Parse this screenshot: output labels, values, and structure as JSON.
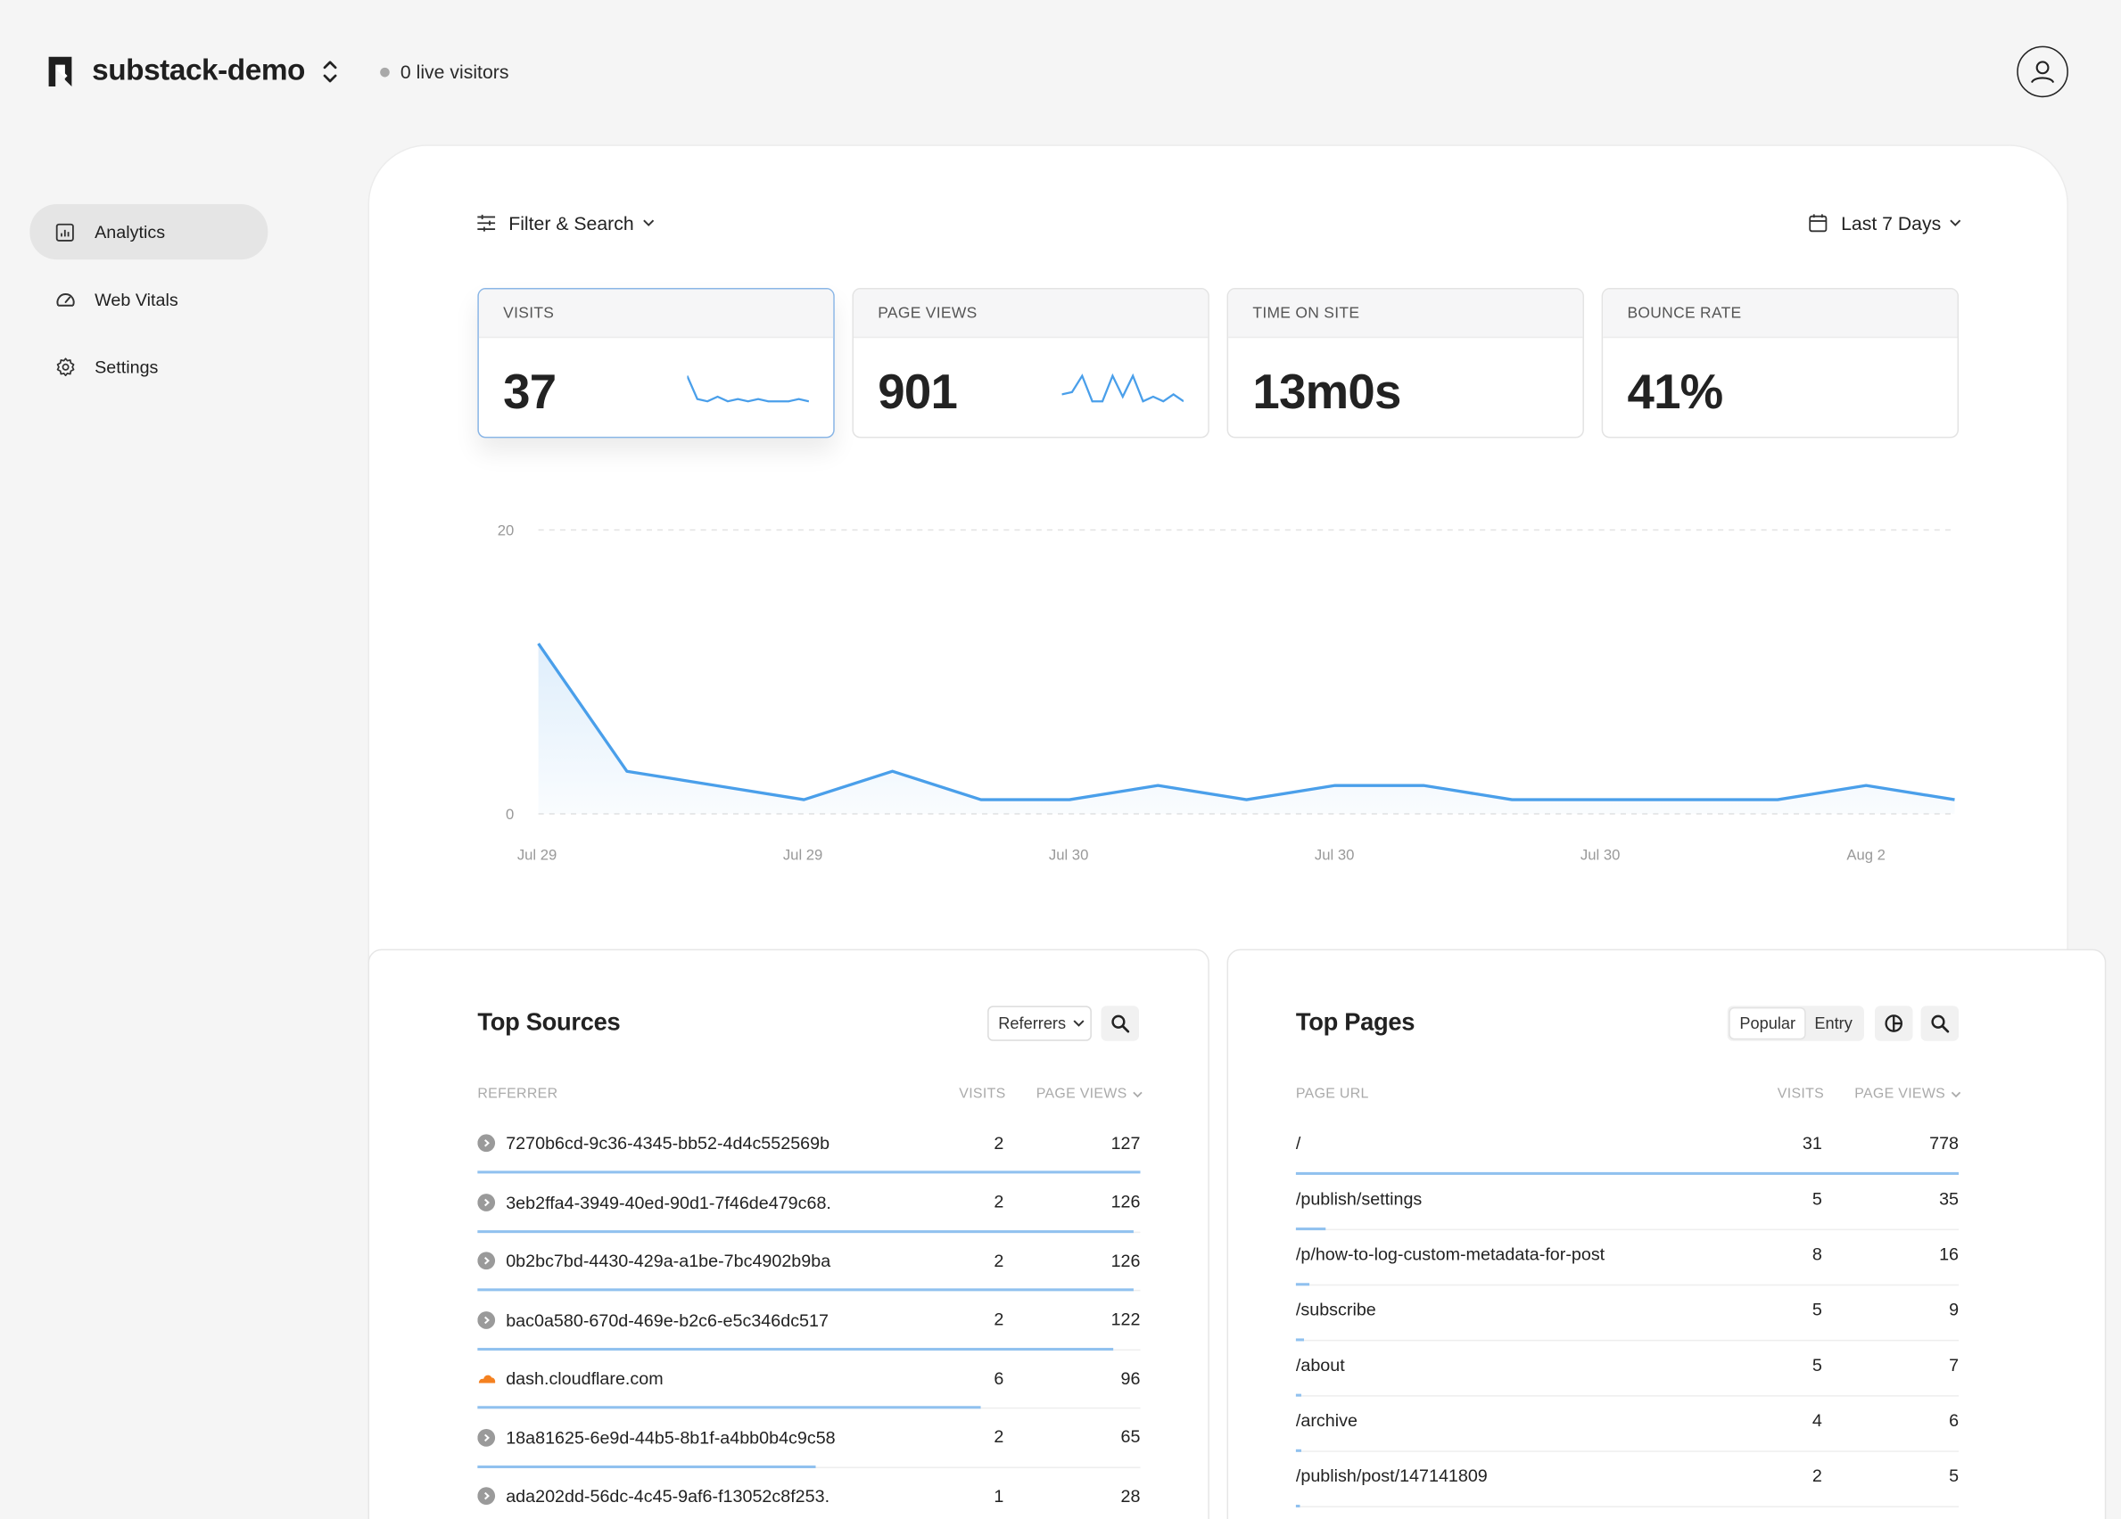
{
  "header": {
    "site_name": "substack-demo",
    "live_visitors": "0 live visitors"
  },
  "sidebar": {
    "items": [
      {
        "label": "Analytics",
        "icon": "bar-chart-icon",
        "active": true
      },
      {
        "label": "Web Vitals",
        "icon": "gauge-icon",
        "active": false
      },
      {
        "label": "Settings",
        "icon": "gear-icon",
        "active": false
      }
    ]
  },
  "toolbar": {
    "filter_label": "Filter & Search",
    "date_range_label": "Last 7 Days"
  },
  "kpis": [
    {
      "label": "VISITS",
      "value": "37",
      "sparkline": [
        14,
        4,
        3,
        5,
        3,
        4,
        3,
        4,
        3,
        3,
        3,
        4,
        3
      ],
      "active": true
    },
    {
      "label": "PAGE VIEWS",
      "value": "901",
      "sparkline": [
        6,
        7,
        14,
        3,
        3,
        14,
        5,
        14,
        3,
        5,
        3,
        6,
        3
      ],
      "active": false
    },
    {
      "label": "TIME ON SITE",
      "value": "13m0s",
      "active": false
    },
    {
      "label": "BOUNCE RATE",
      "value": "41%",
      "active": false
    }
  ],
  "chart_data": {
    "type": "area",
    "title": "",
    "xlabel": "",
    "ylabel": "",
    "ylim": [
      0,
      20
    ],
    "y_ticks": [
      "0",
      "20"
    ],
    "x_tick_labels": [
      "Jul 29",
      "Jul 29",
      "Jul 30",
      "Jul 30",
      "Jul 30",
      "Aug  2"
    ],
    "values": [
      12,
      3,
      2,
      1,
      3,
      1,
      1,
      2,
      1,
      2,
      2,
      1,
      1,
      1,
      1,
      2,
      1
    ],
    "grid": "dashed horizontal",
    "color": "#4a9fea"
  },
  "top_sources": {
    "title": "Top Sources",
    "selector": "Referrers",
    "columns": [
      "REFERRER",
      "VISITS",
      "PAGE VIEWS"
    ],
    "rows": [
      {
        "name": "7270b6cd-9c36-4345-bb52-4d4c552569b",
        "visits": "2",
        "page_views": "127",
        "share": 1.0,
        "icon": "referrer-icon"
      },
      {
        "name": "3eb2ffa4-3949-40ed-90d1-7f46de479c68.",
        "visits": "2",
        "page_views": "126",
        "share": 0.99,
        "icon": "referrer-icon"
      },
      {
        "name": "0b2bc7bd-4430-429a-a1be-7bc4902b9ba",
        "visits": "2",
        "page_views": "126",
        "share": 0.99,
        "icon": "referrer-icon"
      },
      {
        "name": "bac0a580-670d-469e-b2c6-e5c346dc517",
        "visits": "2",
        "page_views": "122",
        "share": 0.96,
        "icon": "referrer-icon"
      },
      {
        "name": "dash.cloudflare.com",
        "visits": "6",
        "page_views": "96",
        "share": 0.76,
        "icon": "cloudflare-icon"
      },
      {
        "name": "18a81625-6e9d-44b5-8b1f-a4bb0b4c9c58",
        "visits": "2",
        "page_views": "65",
        "share": 0.51,
        "icon": "referrer-icon"
      },
      {
        "name": "ada202dd-56dc-4c45-9af6-f13052c8f253.",
        "visits": "1",
        "page_views": "28",
        "share": 0.22,
        "icon": "referrer-icon"
      }
    ]
  },
  "top_pages": {
    "title": "Top Pages",
    "tabs": [
      "Popular",
      "Entry"
    ],
    "active_tab": "Popular",
    "columns": [
      "PAGE URL",
      "VISITS",
      "PAGE VIEWS"
    ],
    "rows": [
      {
        "name": "/",
        "visits": "31",
        "page_views": "778",
        "share": 1.0
      },
      {
        "name": "/publish/settings",
        "visits": "5",
        "page_views": "35",
        "share": 0.045
      },
      {
        "name": "/p/how-to-log-custom-metadata-for-post",
        "visits": "8",
        "page_views": "16",
        "share": 0.021
      },
      {
        "name": "/subscribe",
        "visits": "5",
        "page_views": "9",
        "share": 0.012
      },
      {
        "name": "/about",
        "visits": "5",
        "page_views": "7",
        "share": 0.009
      },
      {
        "name": "/archive",
        "visits": "4",
        "page_views": "6",
        "share": 0.008
      },
      {
        "name": "/publish/post/147141809",
        "visits": "2",
        "page_views": "5",
        "share": 0.006
      }
    ]
  }
}
